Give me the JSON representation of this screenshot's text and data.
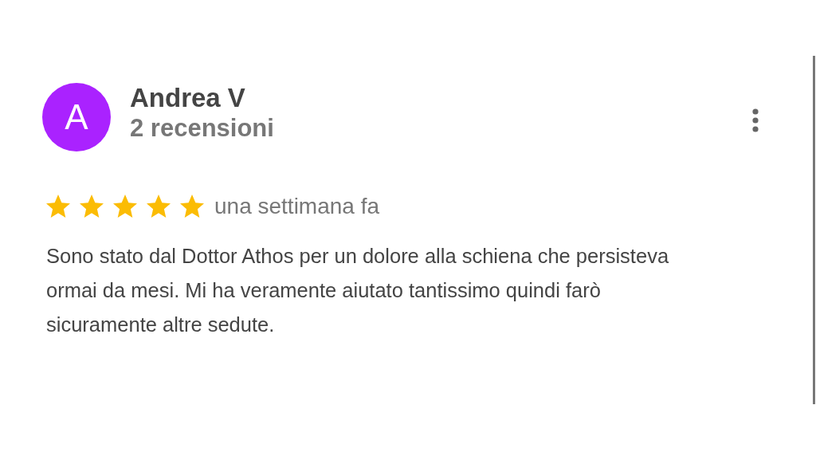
{
  "review": {
    "avatar_letter": "A",
    "author": "Andrea V",
    "review_count": "2 recensioni",
    "stars": 5,
    "date": "una settimana fa",
    "text": "Sono stato dal Dottor Athos per un dolore alla schiena che persisteva ormai da mesi. Mi ha veramente aiutato tantissimo quindi farò sicuramente altre sedute."
  }
}
